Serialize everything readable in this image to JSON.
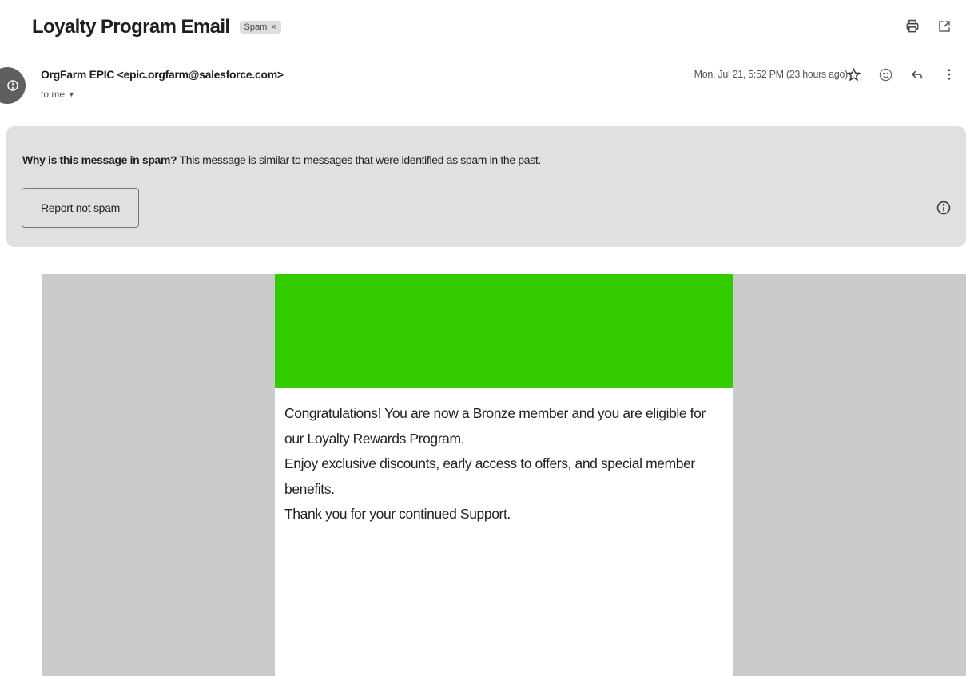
{
  "email": {
    "subject": "Loyalty Program Email",
    "label_chip": "Spam",
    "label_remove": "×",
    "sender": "OrgFarm EPIC <epic.orgfarm@salesforce.com>",
    "recipient": "to me",
    "date": "Mon, Jul 21, 5:52 PM (23 hours ago)"
  },
  "spam_notice": {
    "question": "Why is this message in spam?",
    "explanation": " This message is similar to messages that were identified as spam in the past.",
    "report_button": "Report not spam"
  },
  "body": {
    "header_color": "#33cc00",
    "lines": [
      "Congratulations! You are now a Bronze member and you are eligible for our Loyalty Rewards Program.",
      "Enjoy exclusive discounts, early access to offers, and special member benefits.",
      "Thank you for your continued Support."
    ]
  },
  "icons": {
    "print": "printer-icon",
    "new_window": "open-in-new-window-icon",
    "star": "star-icon",
    "emoji": "emoji-reaction-icon",
    "reply": "reply-icon",
    "more": "more-vertical-icon",
    "info": "info-icon",
    "avatar": "alert-avatar-icon"
  }
}
